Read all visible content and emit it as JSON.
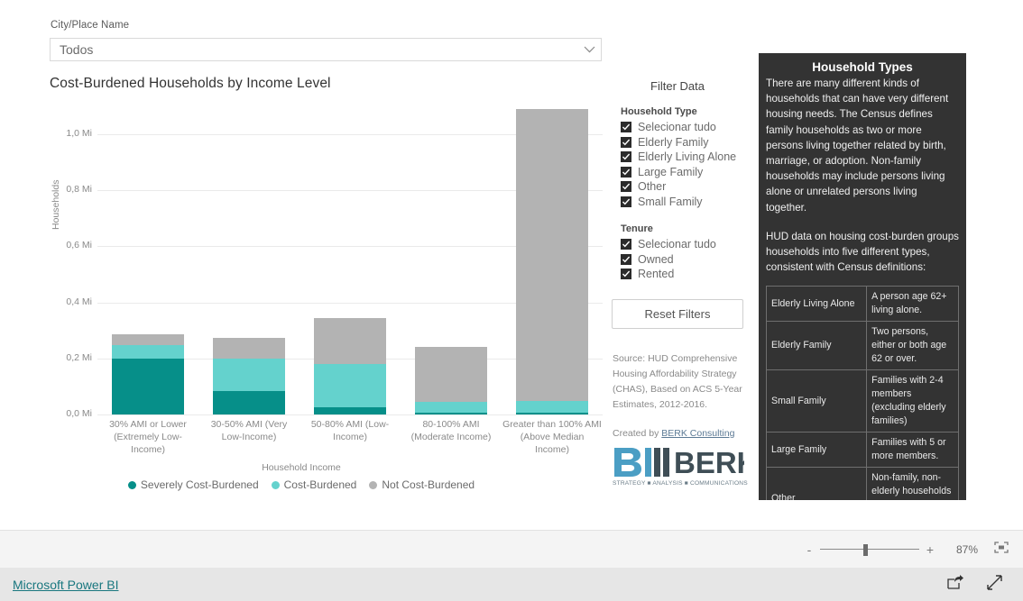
{
  "slicer": {
    "label": "City/Place Name",
    "value": "Todos",
    "chevron_icon": "chevron-down-icon"
  },
  "chart_data": {
    "type": "bar",
    "subtype": "stacked",
    "title": "Cost-Burdened Households by Income Level",
    "xlabel": "Household Income",
    "ylabel": "Households",
    "ylim": [
      0,
      1.1
    ],
    "ytick_labels": [
      "0,0 Mi",
      "0,2 Mi",
      "0,4 Mi",
      "0,6 Mi",
      "0,8 Mi",
      "1,0 Mi"
    ],
    "ytick_values": [
      0,
      0.2,
      0.4,
      0.6,
      0.8,
      1.0
    ],
    "grid": true,
    "units": "millions of households",
    "legend_position": "bottom",
    "categories": [
      "30% AMI or Lower (Extremely Low-Income)",
      "30-50% AMI (Very Low-Income)",
      "50-80% AMI (Low-Income)",
      "80-100% AMI (Moderate Income)",
      "Greater than 100% AMI (Above Median Income)"
    ],
    "series": [
      {
        "name": "Severely Cost-Burdened",
        "color": "#068F89",
        "values": [
          0.198,
          0.085,
          0.025,
          0.006,
          0.005
        ]
      },
      {
        "name": "Cost-Burdened",
        "color": "#64D2CD",
        "values": [
          0.049,
          0.115,
          0.155,
          0.04,
          0.043
        ]
      },
      {
        "name": "Not Cost-Burdened",
        "color": "#B3B3B3",
        "values": [
          0.038,
          0.073,
          0.165,
          0.196,
          1.042
        ]
      }
    ]
  },
  "filters": {
    "title": "Filter Data",
    "groups": [
      {
        "label": "Household Type",
        "items": [
          {
            "label": "Selecionar tudo",
            "checked": true
          },
          {
            "label": "Elderly Family",
            "checked": true
          },
          {
            "label": "Elderly Living Alone",
            "checked": true
          },
          {
            "label": "Large Family",
            "checked": true
          },
          {
            "label": "Other",
            "checked": true
          },
          {
            "label": "Small Family",
            "checked": true
          }
        ]
      },
      {
        "label": "Tenure",
        "items": [
          {
            "label": "Selecionar tudo",
            "checked": true
          },
          {
            "label": "Owned",
            "checked": true
          },
          {
            "label": "Rented",
            "checked": true
          }
        ]
      }
    ],
    "reset_label": "Reset Filters"
  },
  "source": {
    "text": "Source: HUD Comprehensive Housing Affordability Strategy (CHAS), Based on ACS 5-Year Estimates, 2012-2016.",
    "created_prefix": "Created by ",
    "created_link": "BERK Consulting",
    "logo_text": "BERK",
    "logo_tagline": "STRATEGY ■ ANALYSIS ■ COMMUNICATIONS"
  },
  "info_panel": {
    "title": "Household Types",
    "paragraph1": "There are many different kinds of households that can have very different housing needs. The Census defines family households as two or more persons living together related by birth, marriage, or adoption. Non-family households may include persons living alone or unrelated persons living together.",
    "paragraph2": "HUD data on housing cost-burden groups households into five different types, consistent with Census definitions:",
    "table": [
      {
        "term": "Elderly Living Alone",
        "definition": "A person age 62+ living alone."
      },
      {
        "term": "Elderly Family",
        "definition": "Two persons, either or both age 62 or over."
      },
      {
        "term": "Small Family",
        "definition": "Families with 2-4 members (excluding elderly families)"
      },
      {
        "term": "Large Family",
        "definition": "Families with 5 or more members."
      },
      {
        "term": "Other",
        "definition": "Non-family, non-elderly households (includes those living alone)"
      }
    ]
  },
  "statusbar": {
    "zoom_out_label": "-",
    "zoom_in_label": "+",
    "zoom_percent": "87%",
    "fit_icon": "fit-to-page-icon"
  },
  "footer": {
    "link": "Microsoft Power BI",
    "share_icon": "share-icon",
    "fullscreen_icon": "fullscreen-icon"
  }
}
